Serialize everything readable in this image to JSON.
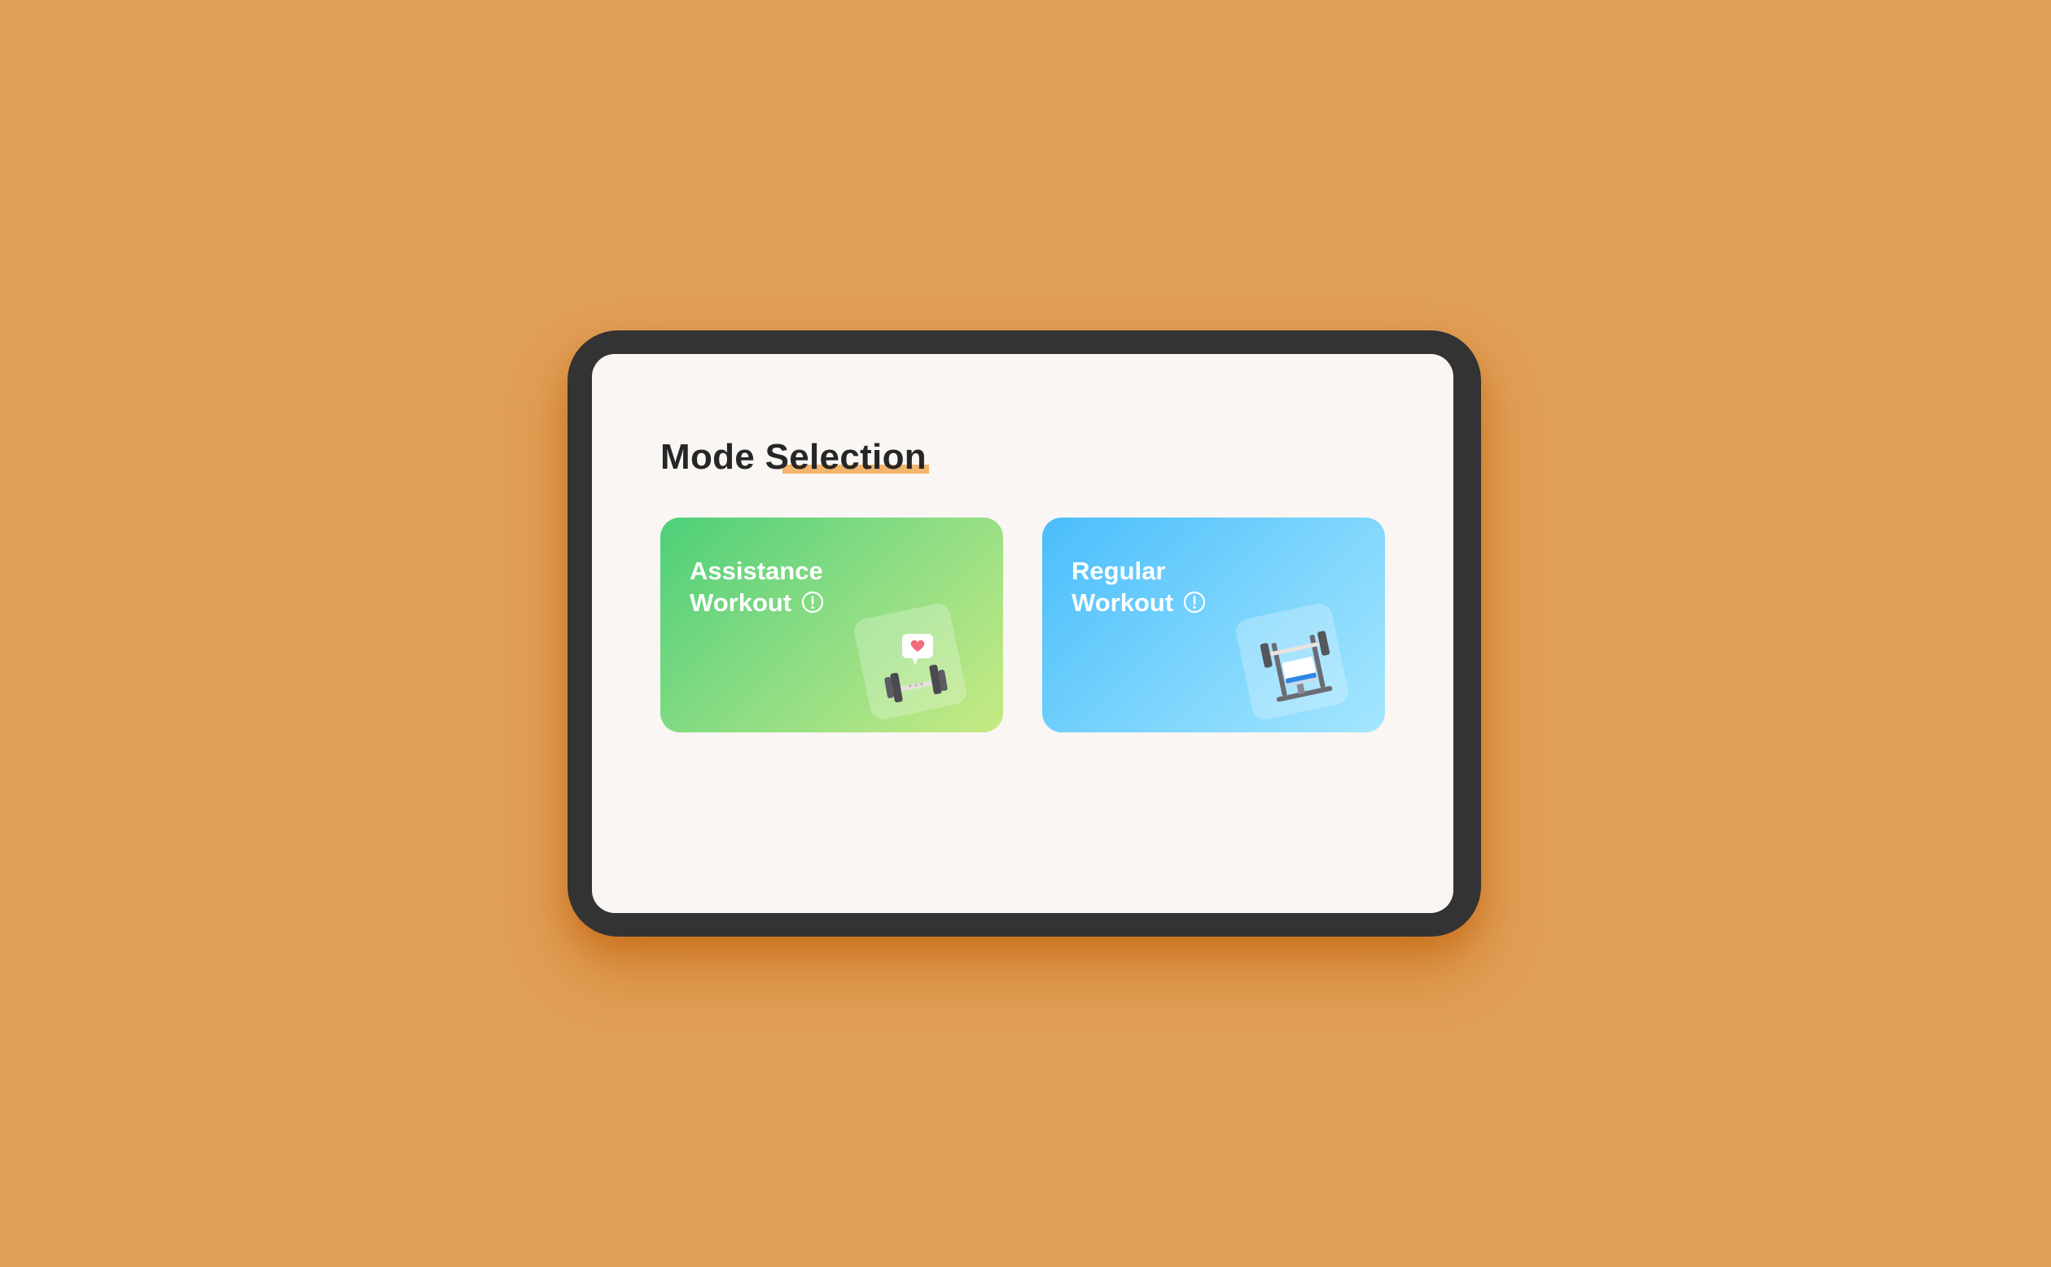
{
  "page": {
    "title": "Mode Selection"
  },
  "modes": [
    {
      "line1": "Assistance",
      "line2": "Workout",
      "gradient": [
        "#4DCF79",
        "#C7EA83"
      ]
    },
    {
      "line1": "Regular",
      "line2": "Workout",
      "gradient": [
        "#4ABDFB",
        "#A5E6FE"
      ]
    }
  ],
  "colors": {
    "background": "#E19F56",
    "bezel": "#333333",
    "screen": "#F9F6F3",
    "title_underline": "#F3B46E"
  },
  "icons": {
    "info": "info-circle-icon",
    "assistance_illustration": "dumbbell-heart-icon",
    "regular_illustration": "bench-press-icon"
  }
}
